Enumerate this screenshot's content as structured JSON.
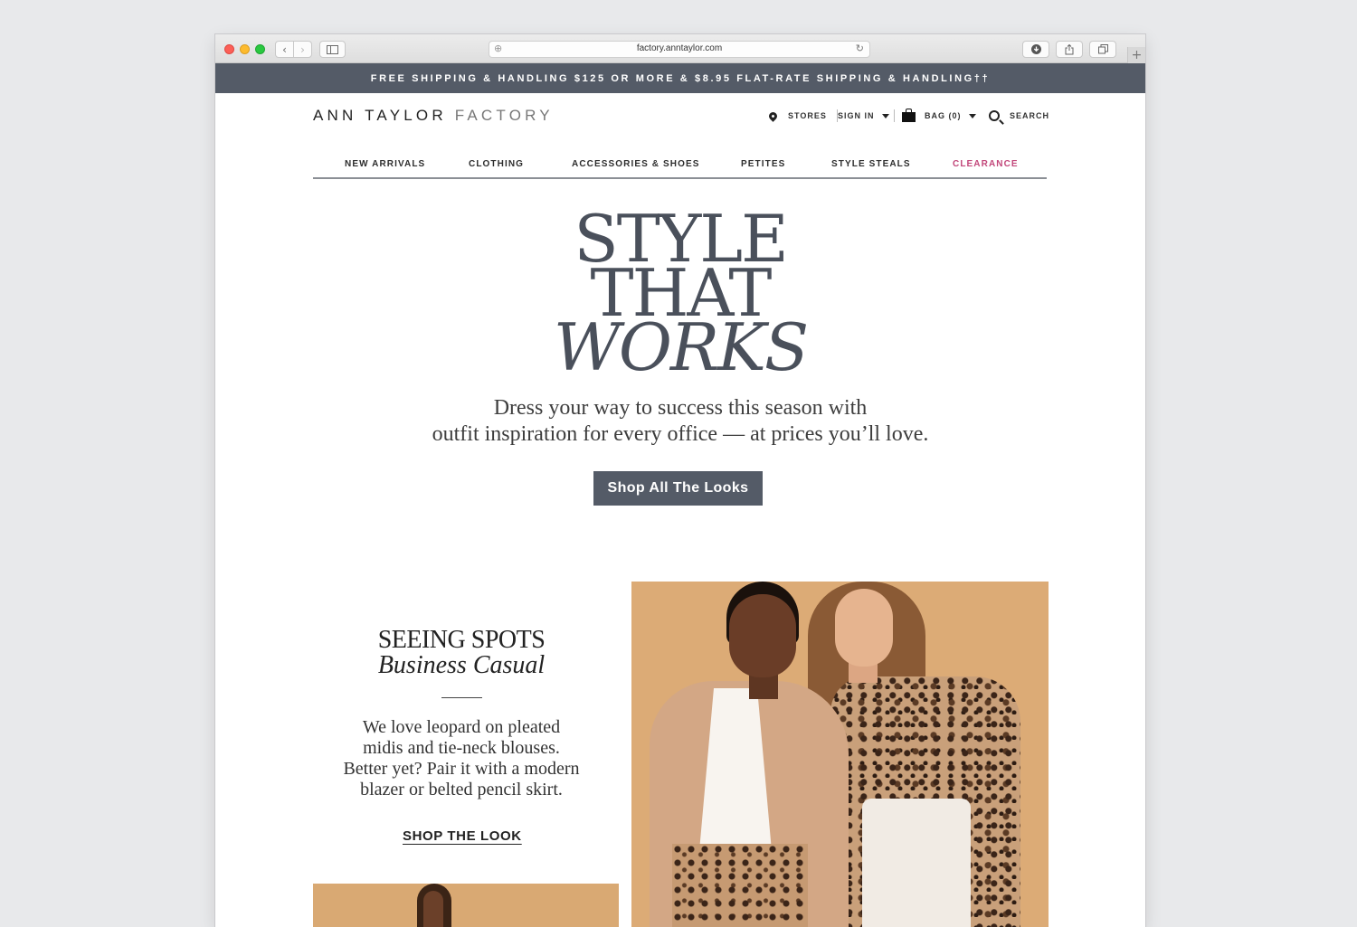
{
  "browser": {
    "url": "factory.anntaylor.com",
    "icons": [
      "back-icon",
      "forward-icon",
      "sidebar-icon",
      "download-icon",
      "share-icon",
      "tabs-icon",
      "new-tab-icon",
      "reload-icon"
    ]
  },
  "promo": {
    "text": "FREE SHIPPING & HANDLING $125 OR MORE & $8.95 FLAT-RATE SHIPPING & HANDLING††"
  },
  "header": {
    "logo_main": "ANN TAYLOR",
    "logo_sub": "FACTORY",
    "stores": "STORES",
    "sign_in": "SIGN IN",
    "bag": "BAG (0)",
    "search": "SEARCH"
  },
  "nav": {
    "items": [
      {
        "label": "NEW ARRIVALS"
      },
      {
        "label": "CLOTHING"
      },
      {
        "label": "ACCESSORIES & SHOES"
      },
      {
        "label": "PETITES"
      },
      {
        "label": "STYLE STEALS"
      },
      {
        "label": "CLEARANCE"
      }
    ]
  },
  "hero": {
    "title_line1": "STYLE",
    "title_line2": "THAT",
    "title_line3": "WORKS",
    "subtitle_line1": "Dress your way to success this season with",
    "subtitle_line2": "outfit inspiration for every office — at prices you’ll love.",
    "cta": "Shop All The Looks"
  },
  "feature": {
    "title_line1": "SEEING SPOTS",
    "title_line2": "Business Casual",
    "copy_line1": "We love leopard on pleated",
    "copy_line2": "midis and tie-neck blouses.",
    "copy_line3": "Better yet? Pair it with a modern",
    "copy_line4": "blazer or belted pencil skirt.",
    "cta": "SHOP THE LOOK"
  },
  "colors": {
    "promo_bar": "#545b67",
    "accent_clearance": "#c2477a",
    "cta_bg": "#545b67",
    "hero_text": "#4a505b"
  }
}
